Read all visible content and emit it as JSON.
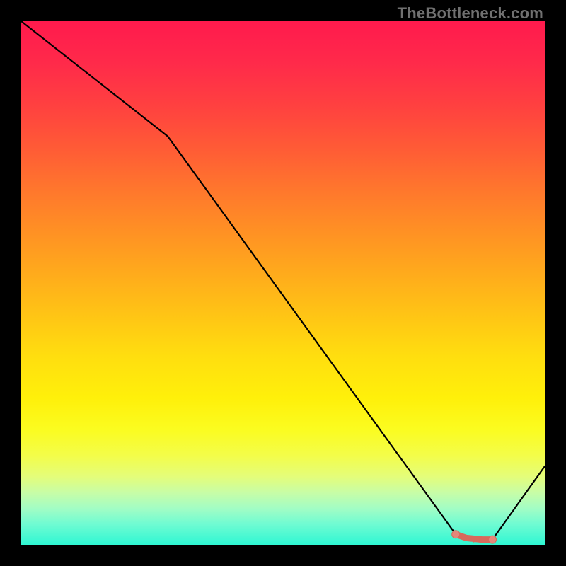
{
  "watermark": "TheBottleneck.com",
  "chart_data": {
    "type": "line",
    "title": "",
    "xlabel": "",
    "ylabel": "",
    "xlim": [
      0,
      100
    ],
    "ylim": [
      0,
      100
    ],
    "grid": false,
    "series": [
      {
        "name": "curve",
        "color": "#000000",
        "x": [
          0,
          28,
          83,
          90,
          100
        ],
        "values": [
          100,
          78,
          2,
          1,
          15
        ]
      },
      {
        "name": "highlight",
        "color": "#d86a5b",
        "x": [
          83,
          85,
          88,
          90
        ],
        "values": [
          2.0,
          1.3,
          1.0,
          1.0
        ]
      }
    ],
    "annotations": []
  },
  "colors": {
    "frame": "#000000",
    "curve": "#000000",
    "highlight_stroke": "#d86a5b",
    "highlight_fill": "#e3887a",
    "watermark": "#707070"
  }
}
